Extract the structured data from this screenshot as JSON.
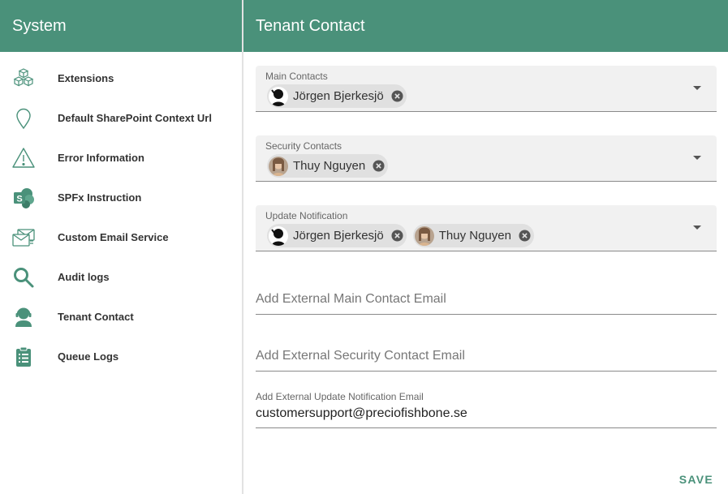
{
  "sidebar": {
    "title": "System",
    "items": [
      {
        "label": "Extensions",
        "icon": "cubes-icon"
      },
      {
        "label": "Default SharePoint Context Url",
        "icon": "map-pin-icon"
      },
      {
        "label": "Error Information",
        "icon": "warning-icon"
      },
      {
        "label": "SPFx Instruction",
        "icon": "sharepoint-icon"
      },
      {
        "label": "Custom Email Service",
        "icon": "email-service-icon"
      },
      {
        "label": "Audit logs",
        "icon": "search-icon"
      },
      {
        "label": "Tenant Contact",
        "icon": "support-agent-icon"
      },
      {
        "label": "Queue Logs",
        "icon": "clipboard-list-icon"
      }
    ]
  },
  "main": {
    "title": "Tenant Contact",
    "main_contacts": {
      "label": "Main Contacts",
      "chips": [
        "Jörgen Bjerkesjö"
      ]
    },
    "security_contacts": {
      "label": "Security Contacts",
      "chips": [
        "Thuy Nguyen"
      ]
    },
    "update_notification": {
      "label": "Update Notification",
      "chips": [
        "Jörgen Bjerkesjö",
        "Thuy Nguyen"
      ]
    },
    "external_main_email": {
      "placeholder": "Add External Main Contact Email",
      "value": ""
    },
    "external_security_email": {
      "placeholder": "Add External Security Contact Email",
      "value": ""
    },
    "external_update_email": {
      "label": "Add External Update Notification Email",
      "value": "customersupport@preciofishbone.se"
    },
    "save_label": "SAVE"
  },
  "colors": {
    "accent": "#4a917a",
    "icon": "#4a917a",
    "field_bg": "#f1f1f1",
    "chip_bg": "#e0e0e0"
  }
}
